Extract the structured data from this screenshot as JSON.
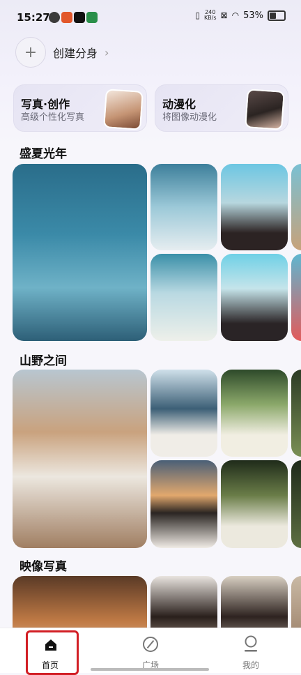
{
  "status_bar": {
    "time": "15:27",
    "net_speed_value": "240",
    "net_speed_unit": "KB/s",
    "battery": "53%"
  },
  "create": {
    "label": "创建分身"
  },
  "cards": [
    {
      "title": "写真·创作",
      "subtitle": "高级个性化写真"
    },
    {
      "title": "动漫化",
      "subtitle": "将图像动漫化"
    }
  ],
  "sections": [
    {
      "title": "盛夏光年"
    },
    {
      "title": "山野之间"
    },
    {
      "title": "映像写真"
    }
  ],
  "nav": [
    {
      "label": "首页",
      "active": true
    },
    {
      "label": "广场",
      "active": false
    },
    {
      "label": "我的",
      "active": false
    }
  ],
  "colors": {
    "highlight": "#d21f25"
  }
}
